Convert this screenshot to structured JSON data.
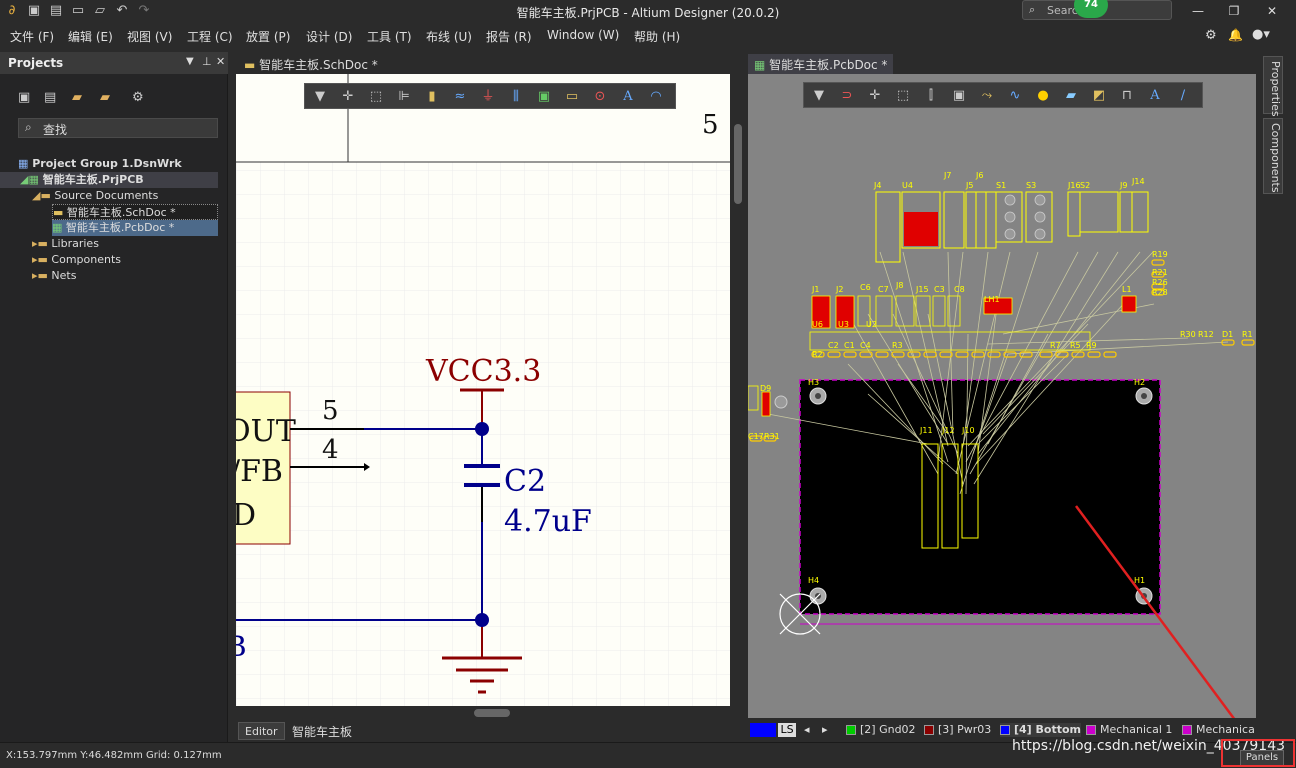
{
  "window": {
    "title": "智能车主板.PrjPCB - Altium Designer (20.0.2)",
    "search_placeholder": "Search",
    "badge": "74"
  },
  "menu": [
    "文件 (F)",
    "编辑 (E)",
    "视图 (V)",
    "工程 (C)",
    "放置 (P)",
    "设计 (D)",
    "工具 (T)",
    "布线 (U)",
    "报告 (R)",
    "Window (W)",
    "帮助 (H)"
  ],
  "projects": {
    "title": "Projects",
    "search_placeholder": "查找",
    "tree": [
      {
        "label": "Project Group 1.DsnWrk"
      },
      {
        "label": "智能车主板.PrjPCB"
      },
      {
        "label": "Source Documents"
      },
      {
        "label": "智能车主板.SchDoc *"
      },
      {
        "label": "智能车主板.PcbDoc *"
      },
      {
        "label": "Libraries"
      },
      {
        "label": "Components"
      },
      {
        "label": "Nets"
      }
    ]
  },
  "schematic": {
    "tab_label": "智能车主板.SchDoc *",
    "border_number": "5",
    "pin5": "5",
    "pin4": "4",
    "text_out": "OUT",
    "text_fb": "/FB",
    "text_d": "D",
    "text_b": "B",
    "net_label": "VCC3.3",
    "cap_designator": "C2",
    "cap_value": "4.7uF",
    "bottom_tabs": [
      "Editor",
      "智能车主板"
    ]
  },
  "pcb": {
    "tab_label": "智能车主板.PcbDoc *",
    "layers": [
      {
        "label": "LS",
        "color": "#0000ff"
      },
      {
        "label": "[2] Gnd02",
        "color": "#00cc00"
      },
      {
        "label": "[3] Pwr03",
        "color": "#8b0000"
      },
      {
        "label": "[4] Bottom",
        "color": "#0000ff"
      },
      {
        "label": "Mechanical 1",
        "color": "#cc00cc"
      },
      {
        "label": "Mechanica",
        "color": "#cc00cc"
      }
    ],
    "designators": [
      "J4",
      "U4",
      "J7",
      "J5",
      "J6",
      "S1",
      "S3",
      "J16",
      "S2",
      "J9",
      "J14",
      "R19",
      "R21",
      "R26",
      "R28",
      "J1",
      "J2",
      "C6",
      "C7",
      "J8",
      "J15",
      "C3",
      "C8",
      "LH1",
      "L1",
      "U6",
      "U3",
      "U2",
      "C2",
      "C1",
      "C4",
      "R3",
      "R5",
      "R7",
      "R9",
      "R1",
      "R2",
      "D1",
      "R12",
      "R30",
      "H3",
      "H2",
      "H4",
      "H1",
      "J11",
      "J12",
      "J10",
      "D9",
      "R31",
      "C17"
    ]
  },
  "side_tabs": [
    "Properties",
    "Components"
  ],
  "status": {
    "coords": "X:153.797mm Y:46.482mm",
    "grid": "Grid: 0.127mm",
    "panels": "Panels"
  },
  "watermark": "https://blog.csdn.net/weixin_40379143"
}
